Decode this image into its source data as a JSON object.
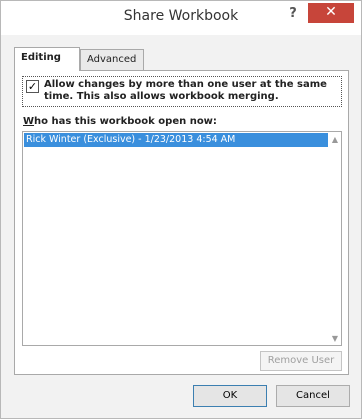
{
  "window": {
    "title": "Share Workbook",
    "help_label": "?",
    "close_label": "✕"
  },
  "tabs": [
    {
      "label": "Editing",
      "active": true
    },
    {
      "label": "Advanced",
      "active": false
    }
  ],
  "editing": {
    "allow_changes_checked": true,
    "check_mark": "✓",
    "allow_changes_text": "Allow changes by more than one user at the same time. This also allows workbook merging.",
    "list_label_accel": "W",
    "list_label_rest": "ho has this workbook open now:",
    "users": [
      {
        "text": "Rick Winter (Exclusive) - 1/23/2013 4:54 AM",
        "selected": true
      }
    ],
    "scroll_up_glyph": "▲",
    "scroll_down_glyph": "▼",
    "remove_user_label": "Remove User"
  },
  "buttons": {
    "ok_label": "OK",
    "cancel_label": "Cancel"
  },
  "colors": {
    "close_button": "#c7453a",
    "selection": "#3a8fdd"
  }
}
